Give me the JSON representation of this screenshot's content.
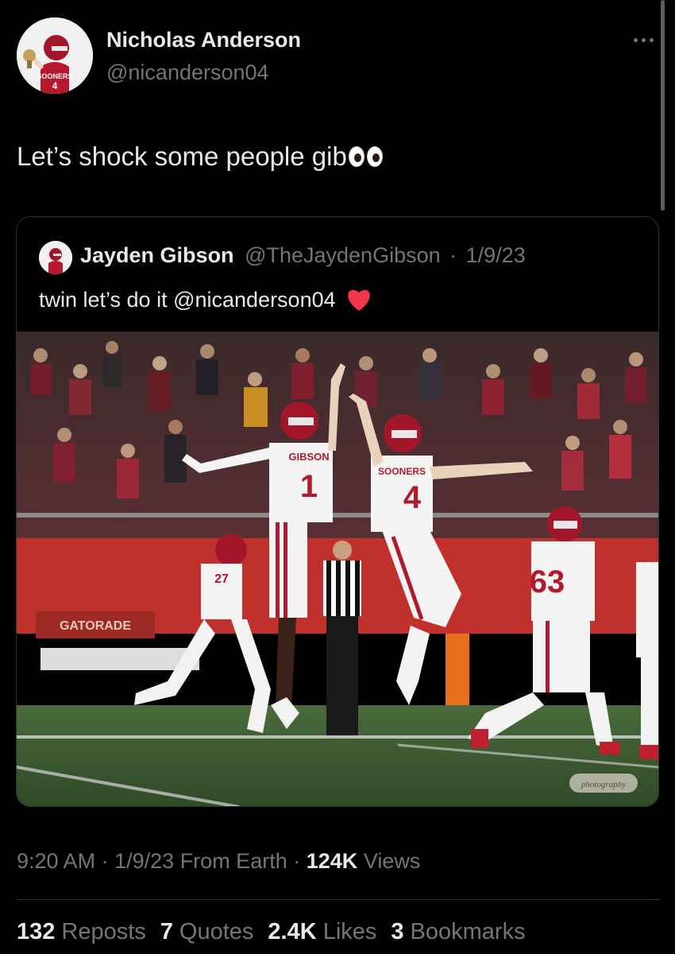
{
  "author": {
    "display_name": "Nicholas Anderson",
    "handle": "@nicanderson04"
  },
  "tweet": {
    "text": "Let’s shock some people gib",
    "emoji": "eyes-emoji"
  },
  "quoted": {
    "display_name": "Jayden Gibson",
    "handle": "@TheJaydenGibson",
    "separator": "·",
    "date": "1/9/23",
    "text": "twin let’s do it @nicanderson04",
    "emoji": "red-heart-emoji",
    "photo": {
      "jersey_left_name": "GIBSON",
      "jersey_left_number": "1",
      "jersey_center_text": "SOONERS",
      "jersey_center_number": "4",
      "jersey_right_number": "63",
      "jersey_back_number": "27",
      "sideline_banner": "GATORADE",
      "watermark": "photography"
    }
  },
  "meta": {
    "time": "9:20 AM",
    "separator": "·",
    "date": "1/9/23",
    "source": "From Earth",
    "views_count": "124K",
    "views_label": "Views"
  },
  "stats": [
    {
      "count": "132",
      "label": "Reposts"
    },
    {
      "count": "7",
      "label": "Quotes"
    },
    {
      "count": "2.4K",
      "label": "Likes"
    },
    {
      "count": "3",
      "label": "Bookmarks"
    }
  ],
  "colors": {
    "background": "#000000",
    "primary_text": "#e7e9ea",
    "secondary_text": "#71767b",
    "border": "#2f3336",
    "oklahoma_crimson": "#b11a2e"
  }
}
